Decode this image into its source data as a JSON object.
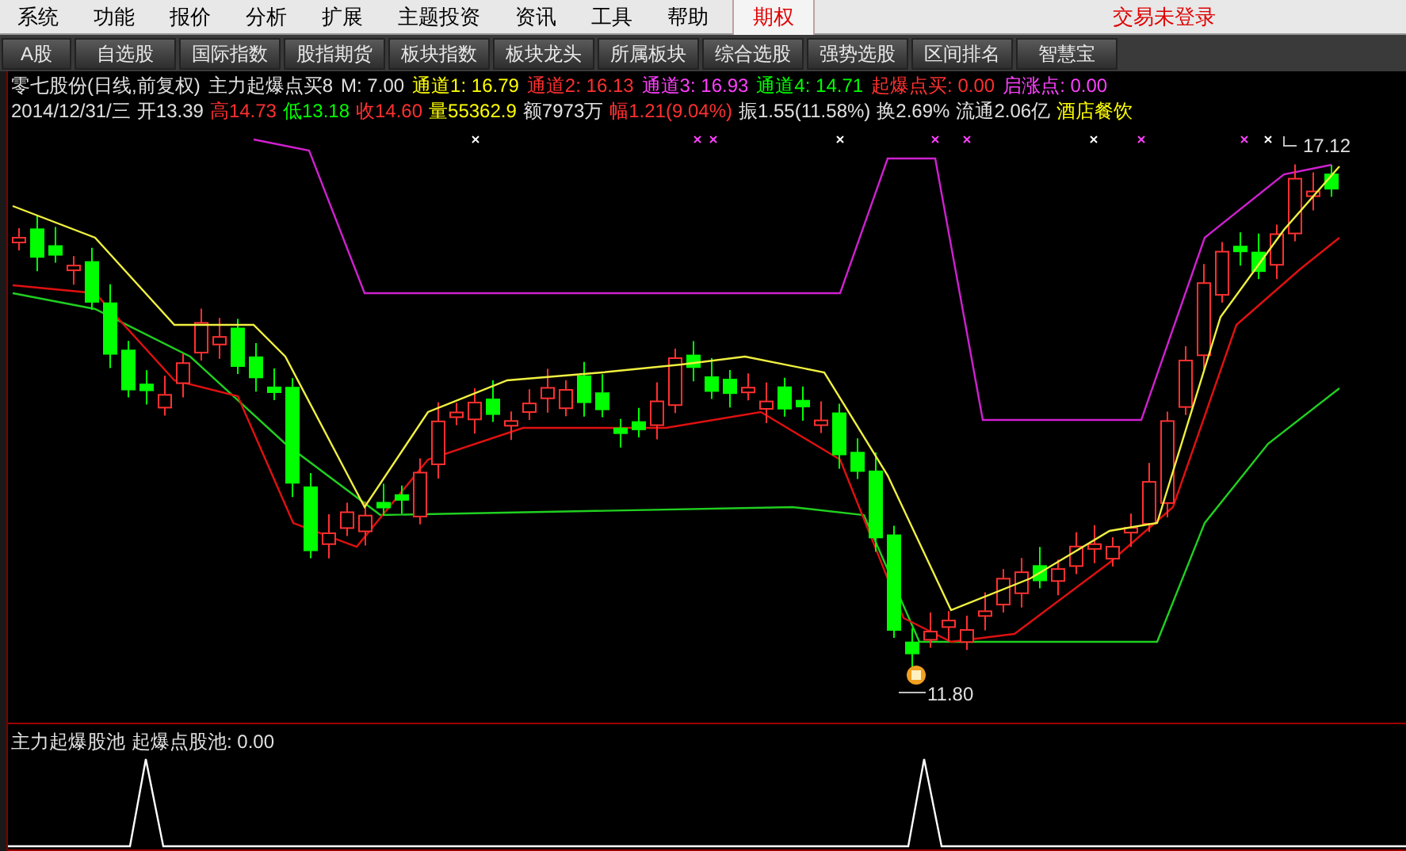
{
  "menu": {
    "items": [
      {
        "label": "系统",
        "selected": false
      },
      {
        "label": "功能",
        "selected": false
      },
      {
        "label": "报价",
        "selected": false
      },
      {
        "label": "分析",
        "selected": false
      },
      {
        "label": "扩展",
        "selected": false
      },
      {
        "label": "主题投资",
        "selected": false
      },
      {
        "label": "资讯",
        "selected": false
      },
      {
        "label": "工具",
        "selected": false
      },
      {
        "label": "帮助",
        "selected": false
      },
      {
        "label": "期权",
        "selected": true
      }
    ],
    "login": "交易未登录"
  },
  "toolbar": [
    "A股",
    "自选股",
    "国际指数",
    "股指期货",
    "板块指数",
    "板块龙头",
    "所属板块",
    "综合选股",
    "强势选股",
    "区间排名",
    "智慧宝"
  ],
  "quote_line": [
    {
      "text": "零七股份(日线,前复权)",
      "color": "#e0e0e0"
    },
    {
      "text": "主力起爆点买8",
      "color": "#e0e0e0"
    },
    {
      "text": "M: 7.00",
      "color": "#e0e0e0"
    },
    {
      "text": "通道1: 16.79",
      "color": "#ffff00"
    },
    {
      "text": "通道2: 16.13",
      "color": "#ff3030"
    },
    {
      "text": "通道3: 16.93",
      "color": "#ff40ff"
    },
    {
      "text": "通道4: 14.71",
      "color": "#00ff00"
    },
    {
      "text": "起爆点买: 0.00",
      "color": "#ff3030"
    },
    {
      "text": "启涨点: 0.00",
      "color": "#ff40ff"
    }
  ],
  "bar_info": [
    {
      "text": "2014/12/31/三",
      "color": "#e0e0e0"
    },
    {
      "text": "开13.39",
      "color": "#e0e0e0"
    },
    {
      "text": "高14.73",
      "color": "#ff3030"
    },
    {
      "text": "低13.18",
      "color": "#00ff00"
    },
    {
      "text": "收14.60",
      "color": "#ff3030"
    },
    {
      "text": "量55362.9",
      "color": "#ffff00"
    },
    {
      "text": "额7973万",
      "color": "#e0e0e0"
    },
    {
      "text": "幅1.21(9.04%)",
      "color": "#ff3030"
    },
    {
      "text": "振1.55(11.58%)",
      "color": "#e0e0e0"
    },
    {
      "text": "换2.69%",
      "color": "#e0e0e0"
    },
    {
      "text": "流通2.06亿",
      "color": "#e0e0e0"
    },
    {
      "text": "酒店餐饮",
      "color": "#ffff00"
    }
  ],
  "chart": {
    "high_label": "17.12",
    "low_label": "11.80"
  },
  "sub_panel": {
    "title": "主力起爆股池",
    "reading": "起爆点股池: 0.00"
  }
}
